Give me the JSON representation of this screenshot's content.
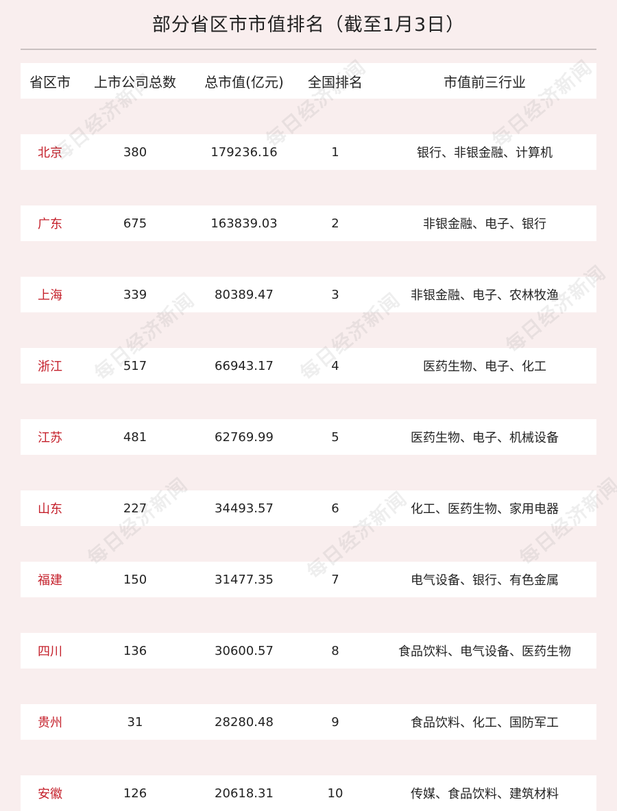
{
  "title": "部分省区市市值排名（截至1月3日）",
  "colors": {
    "background": "#f9eeee",
    "row_background": "#ffffff",
    "province_text": "#c41f2a",
    "rule": "#c9c0c0"
  },
  "watermark_text": "每日经济新闻",
  "headers": {
    "province": "省区市",
    "company_count": "上市公司总数",
    "market_cap": "总市值(亿元)",
    "national_rank": "全国排名",
    "top_industries": "市值前三行业"
  },
  "rows": [
    {
      "province": "北京",
      "count": "380",
      "cap": "179236.16",
      "rank": "1",
      "industries": "银行、非银金融、计算机"
    },
    {
      "province": "广东",
      "count": "675",
      "cap": "163839.03",
      "rank": "2",
      "industries": "非银金融、电子、银行"
    },
    {
      "province": "上海",
      "count": "339",
      "cap": "80389.47",
      "rank": "3",
      "industries": "非银金融、电子、农林牧渔"
    },
    {
      "province": "浙江",
      "count": "517",
      "cap": "66943.17",
      "rank": "4",
      "industries": "医药生物、电子、化工"
    },
    {
      "province": "江苏",
      "count": "481",
      "cap": "62769.99",
      "rank": "5",
      "industries": "医药生物、电子、机械设备"
    },
    {
      "province": "山东",
      "count": "227",
      "cap": "34493.57",
      "rank": "6",
      "industries": "化工、医药生物、家用电器"
    },
    {
      "province": "福建",
      "count": "150",
      "cap": "31477.35",
      "rank": "7",
      "industries": "电气设备、银行、有色金属"
    },
    {
      "province": "四川",
      "count": "136",
      "cap": "30600.57",
      "rank": "8",
      "industries": "食品饮料、电气设备、医药生物"
    },
    {
      "province": "贵州",
      "count": "31",
      "cap": "28280.48",
      "rank": "9",
      "industries": "食品饮料、化工、国防军工"
    },
    {
      "province": "安徽",
      "count": "126",
      "cap": "20618.31",
      "rank": "10",
      "industries": "传媒、食品饮料、建筑材料"
    }
  ]
}
